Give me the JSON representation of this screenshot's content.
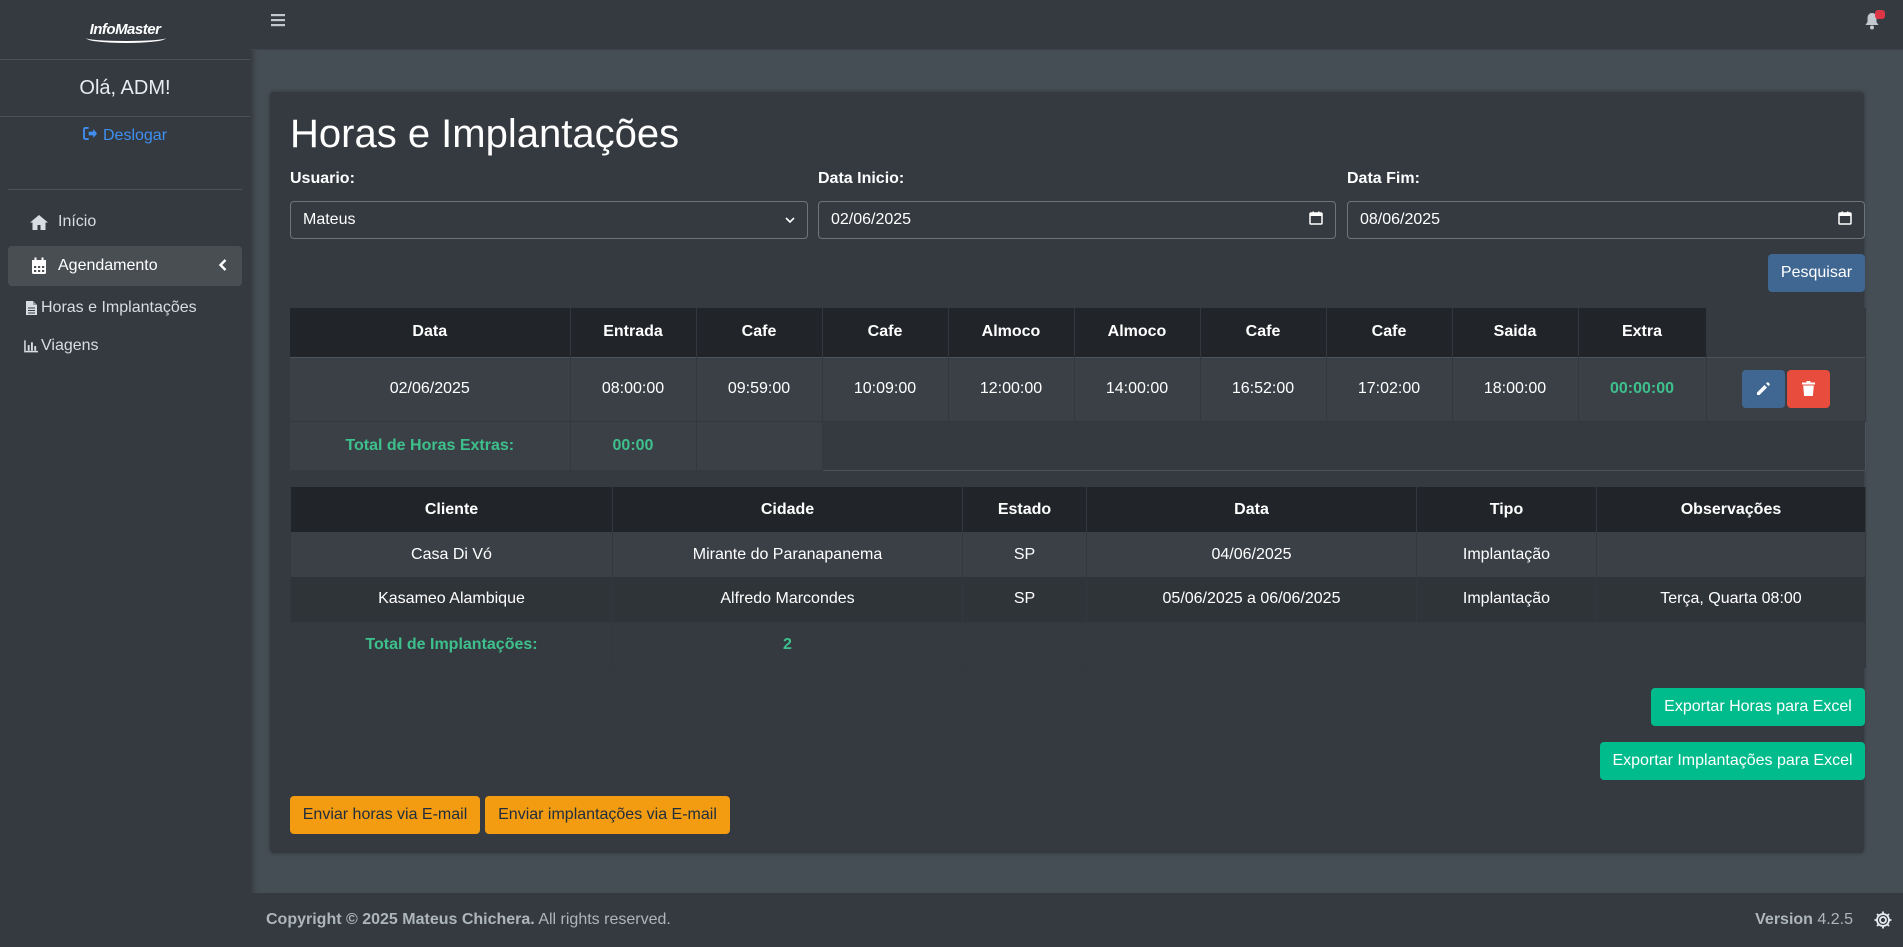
{
  "brand": {
    "logo_text": "InfoMaster"
  },
  "sidebar": {
    "greeting": "Olá, ADM!",
    "logout_label": "Deslogar",
    "items": [
      {
        "label": "Início",
        "icon": "home-icon"
      },
      {
        "label": "Agendamento",
        "icon": "calendar-icon",
        "active": true
      },
      {
        "label": "Horas e Implantações",
        "icon": "file-icon"
      },
      {
        "label": "Viagens",
        "icon": "bar-chart-icon"
      }
    ]
  },
  "page": {
    "title": "Horas e Implantações"
  },
  "filters": {
    "usuario_label": "Usuario:",
    "usuario_value": "Mateus",
    "data_inicio_label": "Data Inicio:",
    "data_inicio_value": "02/06/2025",
    "data_fim_label": "Data Fim:",
    "data_fim_value": "08/06/2025",
    "search_label": "Pesquisar"
  },
  "hours_table": {
    "headers": [
      "Data",
      "Entrada",
      "Cafe",
      "Cafe",
      "Almoco",
      "Almoco",
      "Cafe",
      "Cafe",
      "Saida",
      "Extra"
    ],
    "rows": [
      [
        "02/06/2025",
        "08:00:00",
        "09:59:00",
        "10:09:00",
        "12:00:00",
        "14:00:00",
        "16:52:00",
        "17:02:00",
        "18:00:00",
        "00:00:00"
      ]
    ],
    "total_label": "Total de Horas Extras:",
    "total_value": "00:00"
  },
  "implant_table": {
    "headers": [
      "Cliente",
      "Cidade",
      "Estado",
      "Data",
      "Tipo",
      "Observações"
    ],
    "rows": [
      [
        "Casa Di Vó",
        "Mirante do Paranapanema",
        "SP",
        "04/06/2025",
        "Implantação",
        ""
      ],
      [
        "Kasameo Alambique",
        "Alfredo Marcondes",
        "SP",
        "05/06/2025 a 06/06/2025",
        "Implantação",
        "Terça, Quarta 08:00"
      ]
    ],
    "total_label": "Total de Implantações:",
    "total_value": "2"
  },
  "actions": {
    "export_hours": "Exportar Horas para Excel",
    "export_implant": "Exportar Implantações para Excel",
    "email_hours": "Enviar horas via E-mail",
    "email_implant": "Enviar implantações via E-mail"
  },
  "footer": {
    "copyright": "Copyright © 2025 Mateus Chichera.",
    "rights": "All rights reserved.",
    "version_label": "Version",
    "version_value": "4.2.5"
  },
  "colors": {
    "primary": "#3f6791",
    "success": "#00bc8c",
    "warning": "#f39c12",
    "danger": "#e74c3c",
    "link": "#3f8ff0"
  }
}
